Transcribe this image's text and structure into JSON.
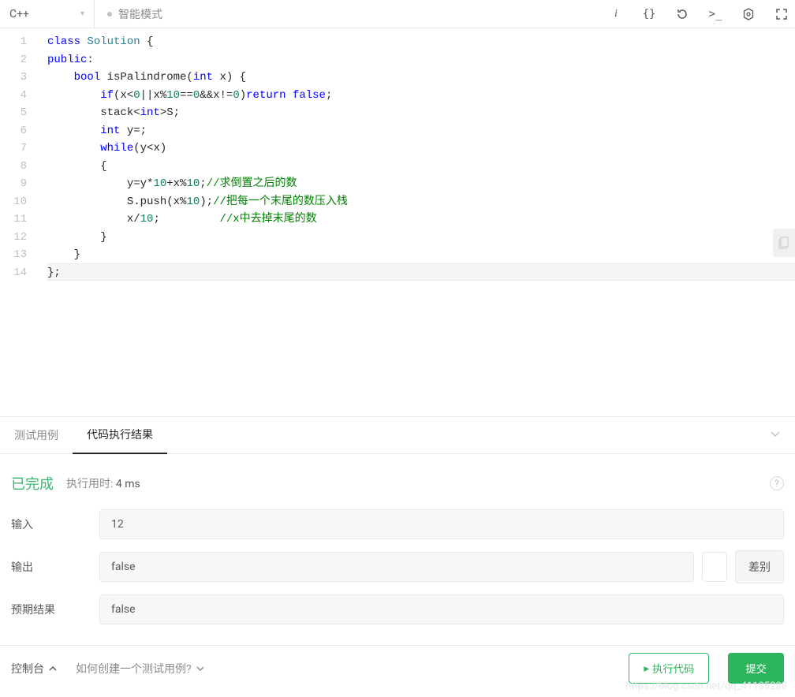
{
  "toolbar": {
    "language": "C++",
    "mode_label": "智能模式"
  },
  "code": {
    "lines": [
      {
        "n": 1,
        "tokens": [
          {
            "t": "class ",
            "c": "kw"
          },
          {
            "t": "Solution",
            "c": "cls"
          },
          {
            "t": " {",
            "c": ""
          }
        ]
      },
      {
        "n": 2,
        "tokens": [
          {
            "t": "public",
            "c": "kw"
          },
          {
            "t": ":",
            "c": ""
          }
        ]
      },
      {
        "n": 3,
        "tokens": [
          {
            "t": "    ",
            "c": ""
          },
          {
            "t": "bool",
            "c": "type"
          },
          {
            "t": " isPalindrome(",
            "c": ""
          },
          {
            "t": "int",
            "c": "type"
          },
          {
            "t": " x) {",
            "c": ""
          }
        ]
      },
      {
        "n": 4,
        "tokens": [
          {
            "t": "        ",
            "c": ""
          },
          {
            "t": "if",
            "c": "kw"
          },
          {
            "t": "(x<",
            "c": ""
          },
          {
            "t": "0",
            "c": "num"
          },
          {
            "t": "||x%",
            "c": ""
          },
          {
            "t": "10",
            "c": "num"
          },
          {
            "t": "==",
            "c": ""
          },
          {
            "t": "0",
            "c": "num"
          },
          {
            "t": "&&x!=",
            "c": ""
          },
          {
            "t": "0",
            "c": "num"
          },
          {
            "t": ")",
            "c": ""
          },
          {
            "t": "return",
            "c": "kw"
          },
          {
            "t": " ",
            "c": ""
          },
          {
            "t": "false",
            "c": "kw"
          },
          {
            "t": ";",
            "c": ""
          }
        ]
      },
      {
        "n": 5,
        "tokens": [
          {
            "t": "        stack<",
            "c": ""
          },
          {
            "t": "int",
            "c": "type"
          },
          {
            "t": ">S;",
            "c": ""
          }
        ]
      },
      {
        "n": 6,
        "tokens": [
          {
            "t": "        ",
            "c": ""
          },
          {
            "t": "int",
            "c": "type"
          },
          {
            "t": " y=;",
            "c": ""
          }
        ]
      },
      {
        "n": 7,
        "tokens": [
          {
            "t": "        ",
            "c": ""
          },
          {
            "t": "while",
            "c": "kw"
          },
          {
            "t": "(y<x)",
            "c": ""
          }
        ]
      },
      {
        "n": 8,
        "tokens": [
          {
            "t": "        {",
            "c": ""
          }
        ]
      },
      {
        "n": 9,
        "tokens": [
          {
            "t": "            y=y*",
            "c": ""
          },
          {
            "t": "10",
            "c": "num"
          },
          {
            "t": "+x%",
            "c": ""
          },
          {
            "t": "10",
            "c": "num"
          },
          {
            "t": ";",
            "c": ""
          },
          {
            "t": "//求倒置之后的数",
            "c": "cmt"
          }
        ]
      },
      {
        "n": 10,
        "tokens": [
          {
            "t": "            S.push(x%",
            "c": ""
          },
          {
            "t": "10",
            "c": "num"
          },
          {
            "t": ");",
            "c": ""
          },
          {
            "t": "//把每一个末尾的数压入栈",
            "c": "cmt"
          }
        ]
      },
      {
        "n": 11,
        "tokens": [
          {
            "t": "            x/",
            "c": ""
          },
          {
            "t": "10",
            "c": "num"
          },
          {
            "t": ";         ",
            "c": ""
          },
          {
            "t": "//x中去掉末尾的数",
            "c": "cmt"
          }
        ]
      },
      {
        "n": 12,
        "tokens": [
          {
            "t": "        }",
            "c": ""
          }
        ]
      },
      {
        "n": 13,
        "tokens": [
          {
            "t": "    }",
            "c": ""
          }
        ]
      },
      {
        "n": 14,
        "tokens": [
          {
            "t": "};",
            "c": ""
          }
        ],
        "cursor": true
      }
    ]
  },
  "panel": {
    "tabs": {
      "testcase": "测试用例",
      "result": "代码执行结果"
    },
    "active_tab": "result"
  },
  "result": {
    "status": "已完成",
    "runtime_prefix": "执行用时: ",
    "runtime_value": "4 ms",
    "rows": {
      "input": {
        "label": "输入",
        "value": "12"
      },
      "output": {
        "label": "输出",
        "value": "false"
      },
      "expected": {
        "label": "预期结果",
        "value": "false"
      }
    },
    "diff_button": "差别"
  },
  "bottom": {
    "console": "控制台",
    "help_link": "如何创建一个测试用例?",
    "run_button": "执行代码",
    "submit_button": "提交"
  },
  "watermark": "https://blog.csdn.net/qq_41185288"
}
